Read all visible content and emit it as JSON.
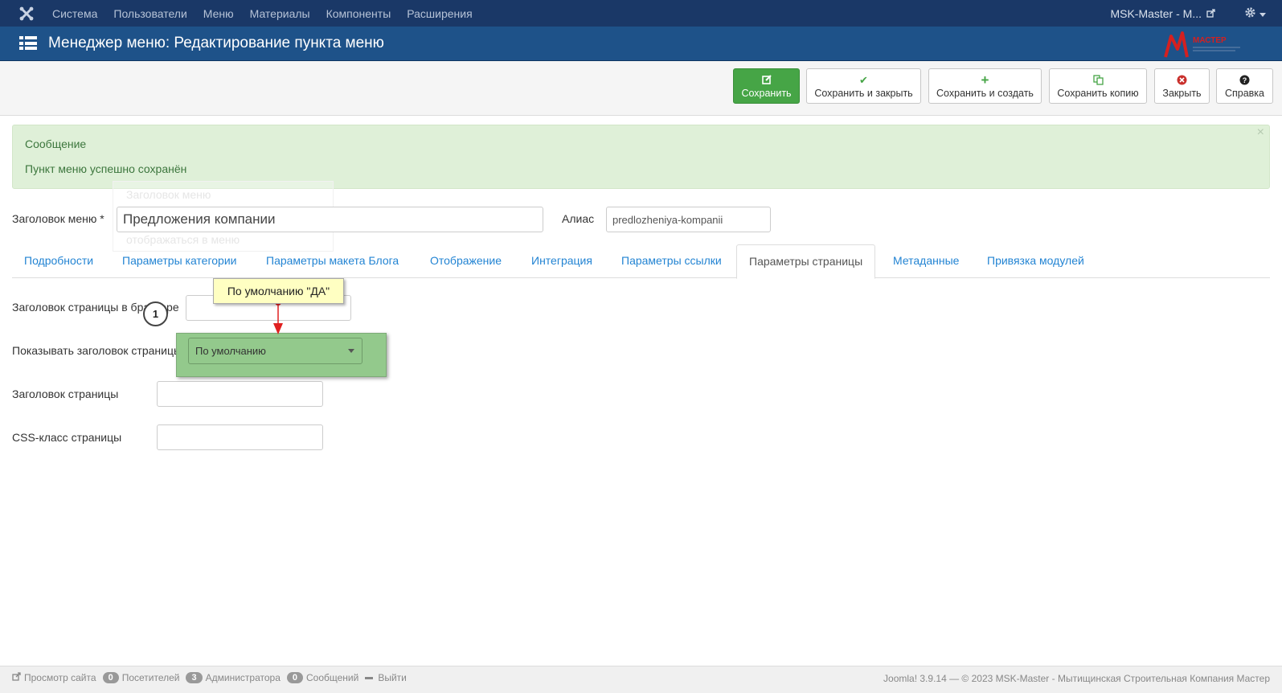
{
  "navbar": {
    "menu": [
      "Система",
      "Пользователи",
      "Меню",
      "Материалы",
      "Компоненты",
      "Расширения"
    ],
    "site_name": "MSK-Master - M..."
  },
  "titlebar": {
    "title": "Менеджер меню: Редактирование пункта меню",
    "logo_text": "МАСТЕР"
  },
  "toolbar": {
    "save": "Сохранить",
    "save_close": "Сохранить и закрыть",
    "save_new": "Сохранить и создать",
    "save_copy": "Сохранить копию",
    "close": "Закрыть",
    "help": "Справка"
  },
  "alert": {
    "heading": "Сообщение",
    "text": "Пункт меню успешно сохранён",
    "close": "×"
  },
  "ghost": {
    "line1": "Заголовок меню",
    "line2": "отображаться в меню"
  },
  "form": {
    "title_label": "Заголовок меню *",
    "title_value": "Предложения компании",
    "alias_label": "Алиас",
    "alias_value": "predlozheniya-kompanii"
  },
  "tabs": [
    "Подробности",
    "Параметры категории",
    "Параметры макета Блога",
    "Отображение",
    "Интеграция",
    "Параметры ссылки",
    "Параметры страницы",
    "Метаданные",
    "Привязка модулей"
  ],
  "page_params": {
    "browser_title_label": "Заголовок страницы в браузере",
    "show_heading_label": "Показывать заголовок страницы",
    "show_heading_value": "По умолчанию",
    "page_heading_label": "Заголовок страницы",
    "css_class_label": "CSS-класс страницы"
  },
  "annotation": {
    "badge": "1",
    "tooltip": "По умолчанию \"ДА\""
  },
  "footer": {
    "view_site": "Просмотр сайта",
    "visitors_count": "0",
    "visitors": "Посетителей",
    "admins_count": "3",
    "admins": "Администратора",
    "messages_count": "0",
    "messages": "Сообщений",
    "logout": "Выйти",
    "copyright": "Joomla! 3.9.14  —  © 2023 MSK-Master - Мытищинская Строительная Компания Мастер"
  },
  "colors": {
    "navbar": "#1a3867",
    "titlebar": "#1e5289",
    "save_button": "#46a546",
    "alert_bg": "#dff0d8",
    "highlight": "#93c98c",
    "tab_link": "#2384d3"
  }
}
